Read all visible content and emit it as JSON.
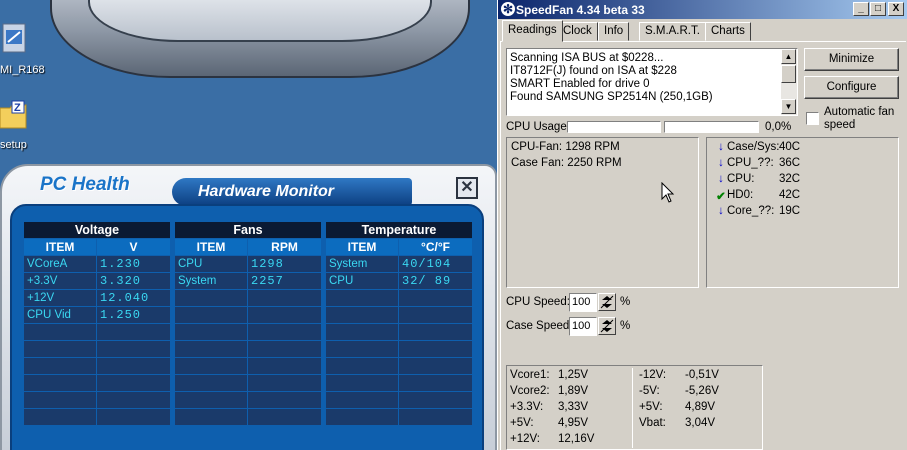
{
  "desktop": {
    "icons": [
      {
        "label": "MI_R168",
        "icon": "app-icon"
      },
      {
        "label": "setup",
        "icon": "zip-folder-icon"
      }
    ]
  },
  "pc_health": {
    "title_left": "PC Health",
    "title_right": "Hardware Monitor",
    "close_icon": "close-icon",
    "voltage": {
      "header": "Voltage",
      "columns": [
        "ITEM",
        "V"
      ],
      "rows": [
        [
          "VCoreA",
          "1.230"
        ],
        [
          "+3.3V",
          "3.320"
        ],
        [
          "+12V",
          "12.040"
        ],
        [
          "CPU Vid",
          "1.250"
        ],
        [
          "",
          ""
        ],
        [
          "",
          ""
        ],
        [
          "",
          ""
        ],
        [
          "",
          ""
        ],
        [
          "",
          ""
        ],
        [
          "",
          ""
        ]
      ]
    },
    "fans": {
      "header": "Fans",
      "columns": [
        "ITEM",
        "RPM"
      ],
      "rows": [
        [
          "CPU",
          "1298"
        ],
        [
          "System",
          "2257"
        ],
        [
          "",
          ""
        ],
        [
          "",
          ""
        ],
        [
          "",
          ""
        ],
        [
          "",
          ""
        ],
        [
          "",
          ""
        ],
        [
          "",
          ""
        ],
        [
          "",
          ""
        ],
        [
          "",
          ""
        ]
      ]
    },
    "temperature": {
      "header": "Temperature",
      "columns": [
        "ITEM",
        "°C/°F"
      ],
      "rows": [
        [
          "System",
          "40/104"
        ],
        [
          "CPU",
          "32/ 89"
        ],
        [
          "",
          ""
        ],
        [
          "",
          ""
        ],
        [
          "",
          ""
        ],
        [
          "",
          ""
        ],
        [
          "",
          ""
        ],
        [
          "",
          ""
        ],
        [
          "",
          ""
        ],
        [
          "",
          ""
        ]
      ]
    }
  },
  "speedfan": {
    "title": "SpeedFan 4.34 beta 33",
    "window_buttons": [
      "_",
      "□",
      "X"
    ],
    "tabs": [
      "Readings",
      "Clock",
      "Info",
      "S.M.A.R.T.",
      "Charts"
    ],
    "active_tab": "Readings",
    "log": [
      "Scanning ISA BUS at $0228...",
      "IT8712F(J) found on ISA at $228",
      "SMART Enabled for drive 0",
      "Found SAMSUNG SP2514N (250,1GB)"
    ],
    "buttons": {
      "minimize": "Minimize",
      "configure": "Configure"
    },
    "auto_fan": {
      "label_line1": "Automatic fan",
      "label_line2": "speed",
      "checked": false
    },
    "cpu_usage": {
      "label": "CPU Usage",
      "value": "0,0%",
      "fraction": 0.0
    },
    "fans": [
      "CPU-Fan: 1298 RPM",
      "Case Fan: 2250 RPM"
    ],
    "temps": [
      {
        "name": "Case/Sys:",
        "value": "40C",
        "icon": "arrow-down-icon",
        "color": "#0000cc"
      },
      {
        "name": "CPU_??:",
        "value": "36C",
        "icon": "arrow-down-icon",
        "color": "#0000cc"
      },
      {
        "name": "CPU:",
        "value": "32C",
        "icon": "arrow-down-icon",
        "color": "#0000cc"
      },
      {
        "name": "HD0:",
        "value": "42C",
        "icon": "check-icon",
        "color": "#008000"
      },
      {
        "name": "Core_??:",
        "value": "19C",
        "icon": "arrow-down-icon",
        "color": "#0000cc"
      }
    ],
    "cpu_speed": {
      "label": "CPU Speed:",
      "value": "100",
      "unit": "%"
    },
    "case_speed": {
      "label": "Case Speed:",
      "value": "100",
      "unit": "%"
    },
    "voltages_left": [
      [
        "Vcore1:",
        "1,25V"
      ],
      [
        "Vcore2:",
        "1,89V"
      ],
      [
        "+3.3V:",
        "3,33V"
      ],
      [
        "+5V:",
        "4,95V"
      ],
      [
        "+12V:",
        "12,16V"
      ]
    ],
    "voltages_right": [
      [
        "-12V:",
        "-0,51V"
      ],
      [
        "-5V:",
        "-5,26V"
      ],
      [
        "+5V:",
        "4,89V"
      ],
      [
        "Vbat:",
        "3,04V"
      ]
    ]
  }
}
